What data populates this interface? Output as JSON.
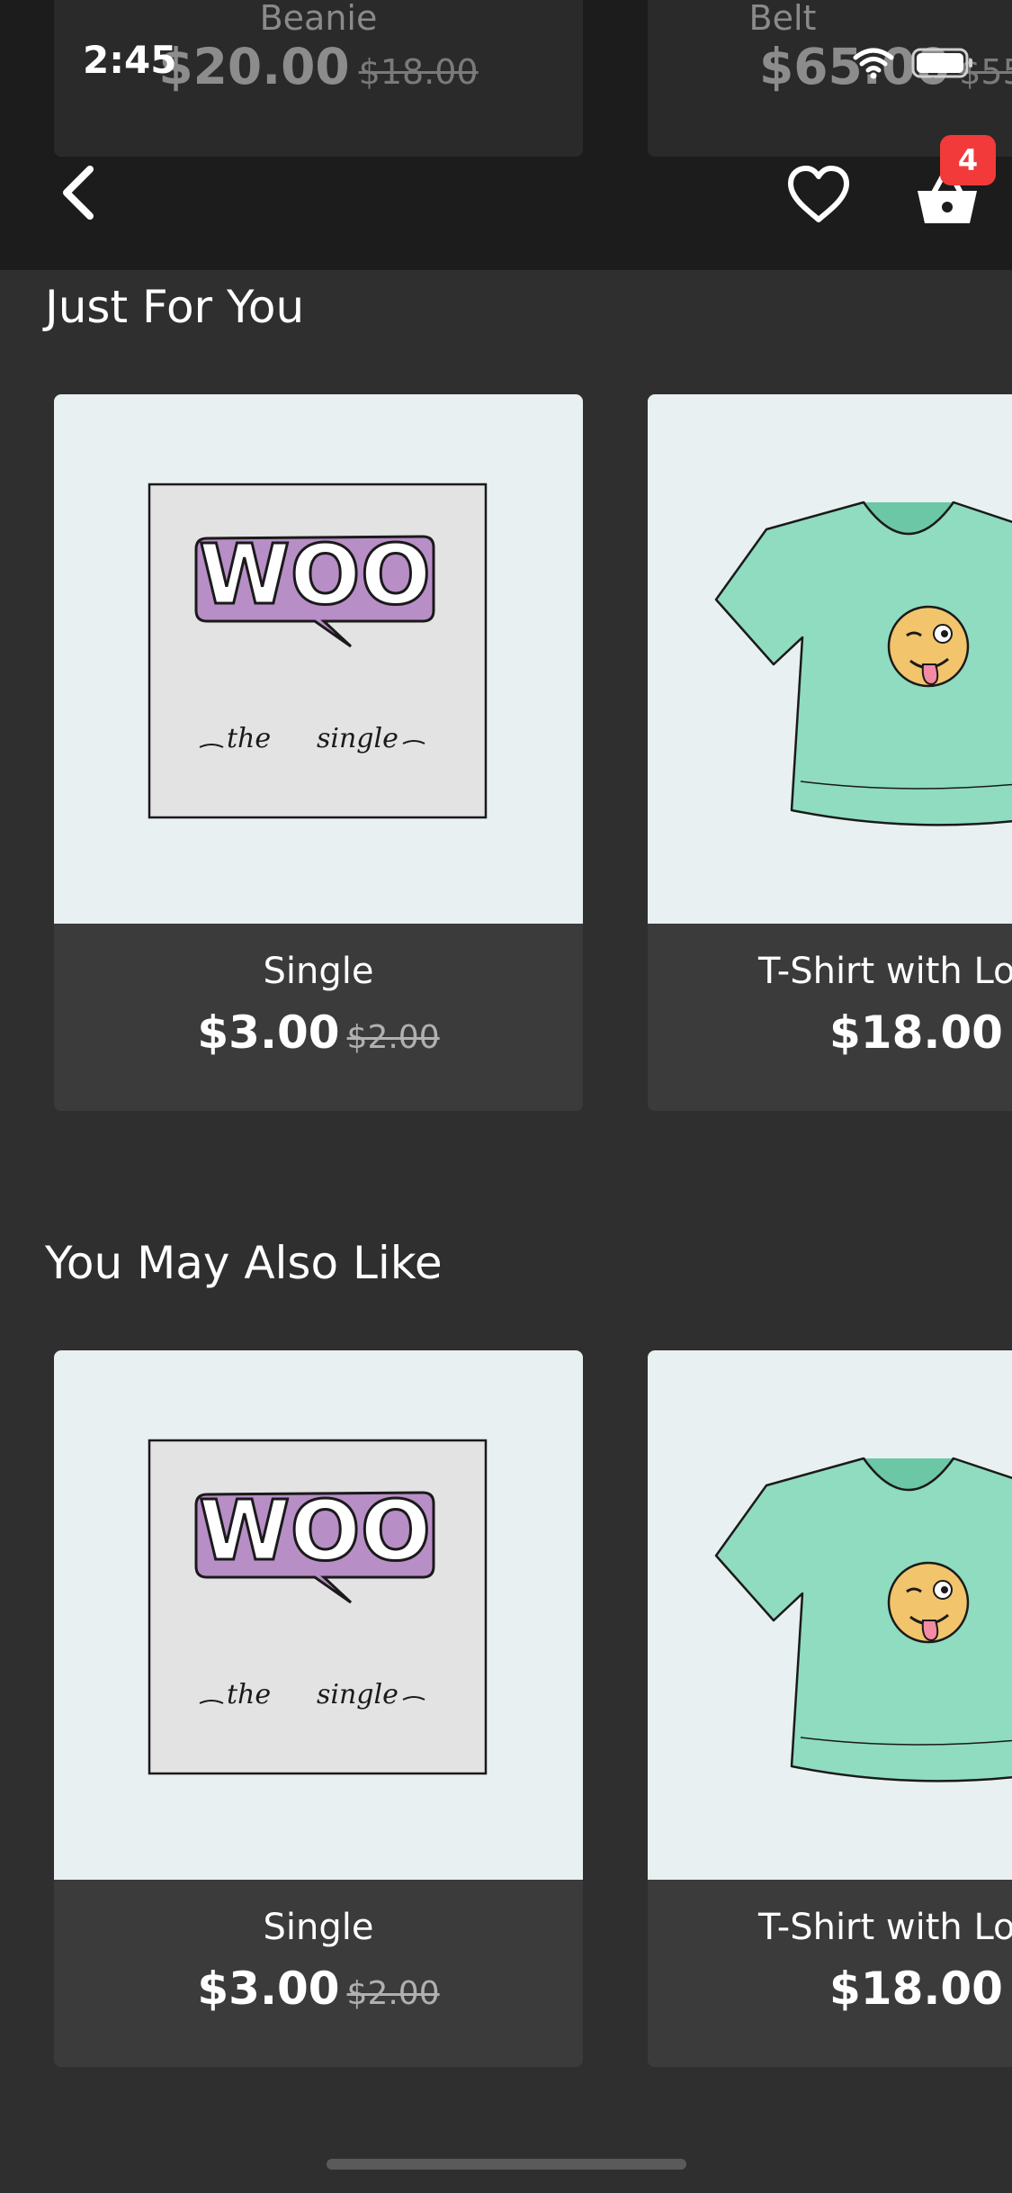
{
  "status_bar": {
    "time": "2:45",
    "wifi_icon": "wifi-icon",
    "battery_icon": "battery-icon"
  },
  "header": {
    "peek_products": [
      {
        "name": "Beanie",
        "price": "$20.00",
        "regular_price": "$18.00"
      },
      {
        "name": "Belt",
        "price": "$65.00",
        "regular_price": "$55."
      }
    ],
    "back_icon": "chevron-left-icon",
    "wishlist_icon": "heart-icon",
    "cart_icon": "basket-icon",
    "cart_count": "4"
  },
  "sections": [
    {
      "title": "Just For You",
      "products": [
        {
          "name": "Single",
          "price": "$3.00",
          "regular_price": "$2.00",
          "image": "woo-single-art"
        },
        {
          "name": "T-Shirt with Lo",
          "price": "$18.00",
          "regular_price": "",
          "image": "green-tshirt-emoji"
        }
      ]
    },
    {
      "title": "You May Also Like",
      "products": [
        {
          "name": "Single",
          "price": "$3.00",
          "regular_price": "$2.00",
          "image": "woo-single-art"
        },
        {
          "name": "T-Shirt with Lo",
          "price": "$18.00",
          "regular_price": "",
          "image": "green-tshirt-emoji"
        }
      ]
    }
  ],
  "colors": {
    "background": "#2f2f2f",
    "header": "#1c1c1c",
    "card_info": "#3b3b3b",
    "card_image_bg": "#e8f0f1",
    "badge": "#f23a3a",
    "woo_purple": "#b88ec6",
    "tshirt_green": "#8fdcc0"
  }
}
